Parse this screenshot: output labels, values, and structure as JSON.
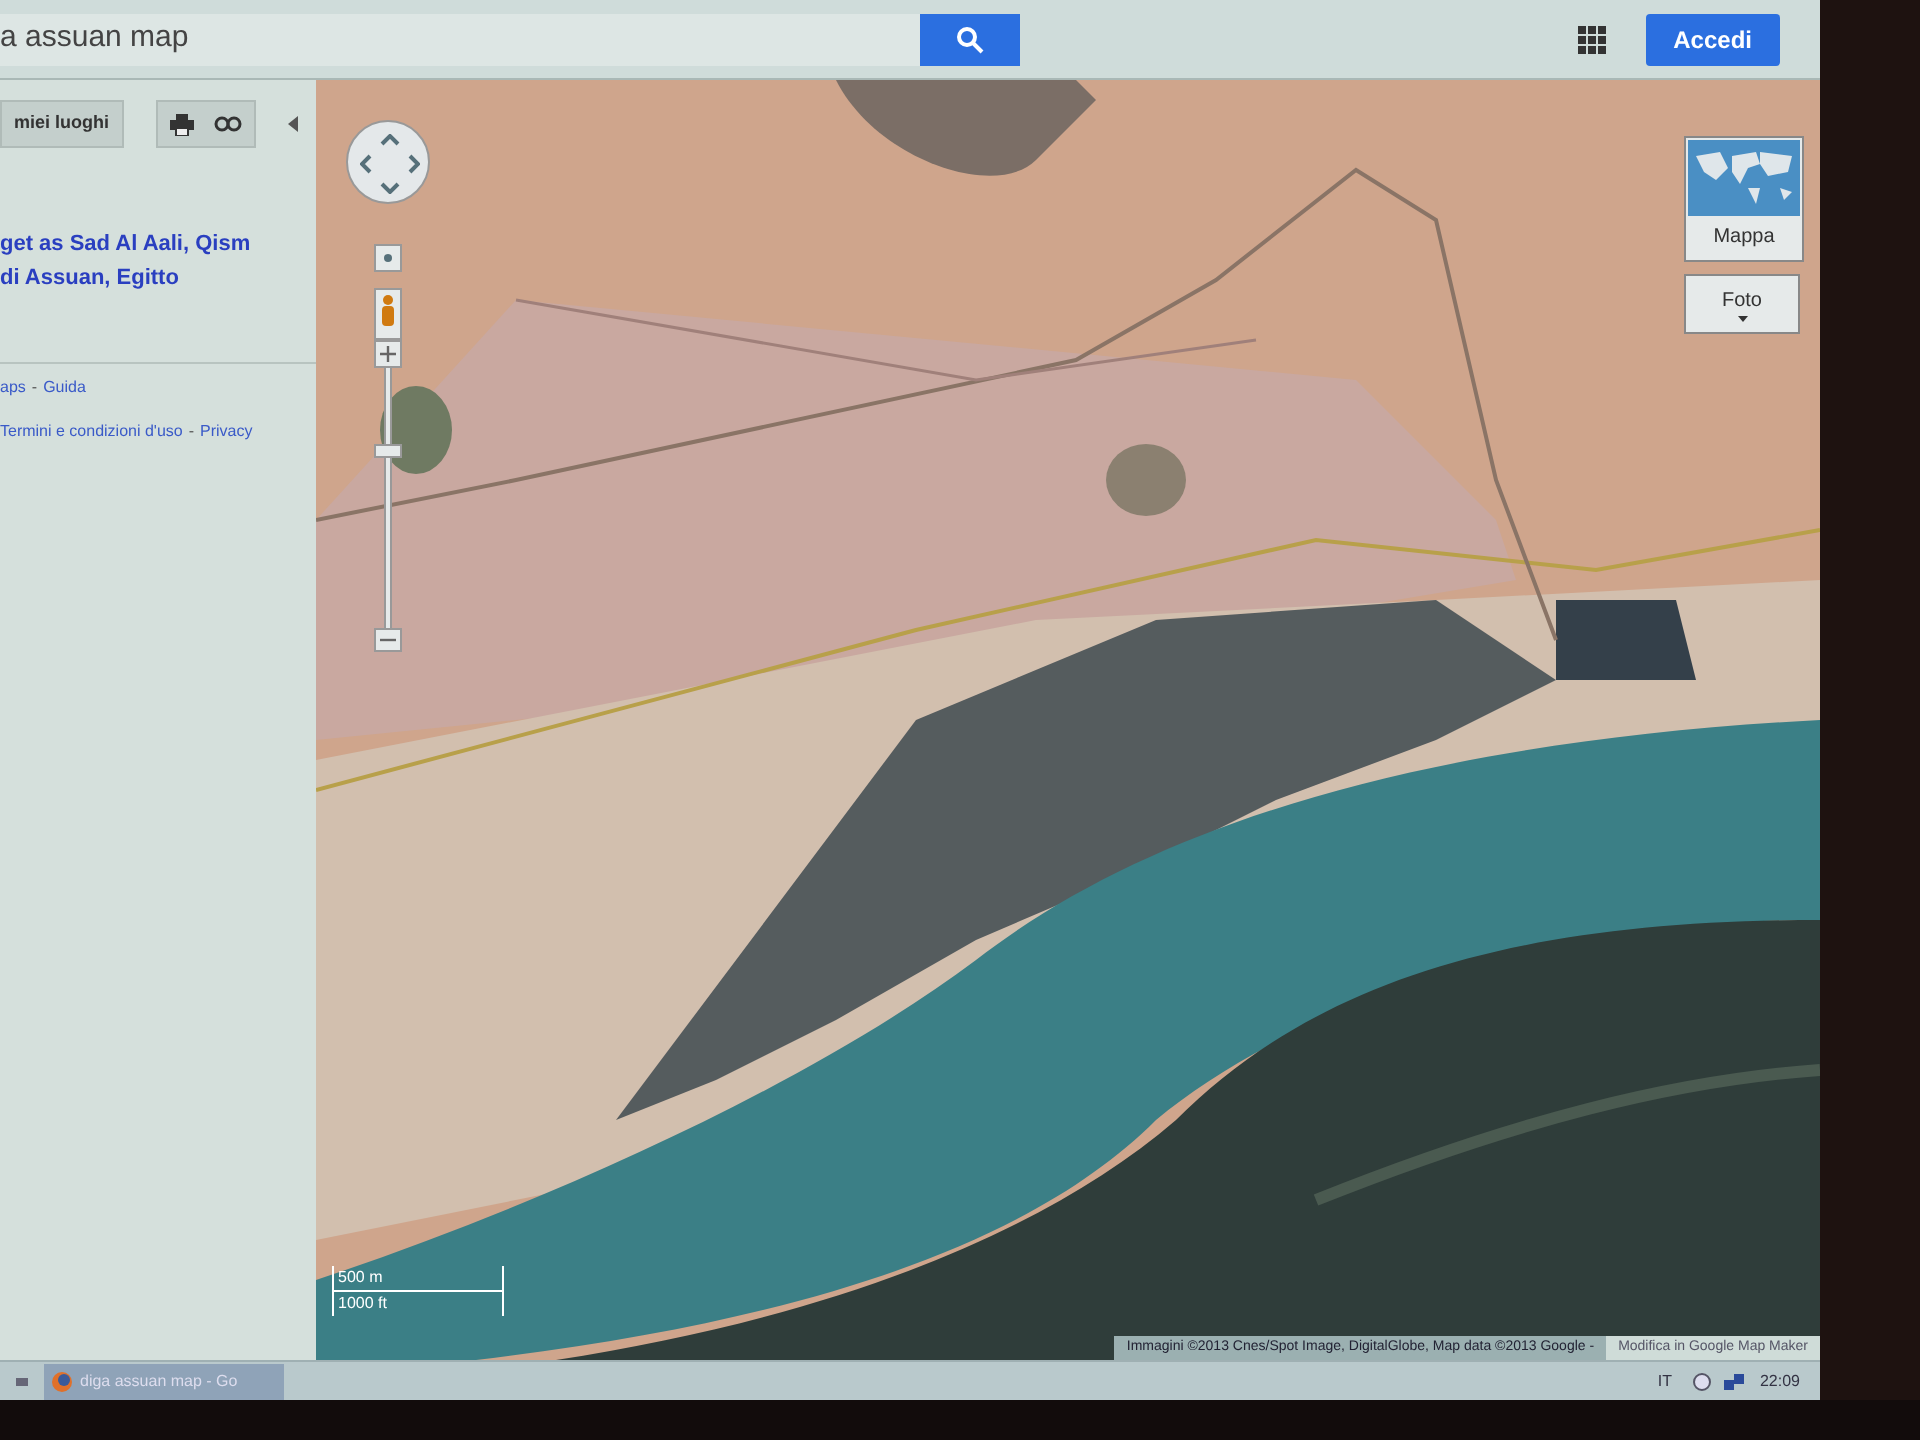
{
  "search": {
    "value": "a assuan map"
  },
  "header": {
    "sign_in": "Accedi"
  },
  "sidebar": {
    "my_places": "miei luoghi",
    "place_lines": [
      "get as Sad Al Aali, Qism",
      "di Assuan, Egitto"
    ],
    "footer_links": [
      [
        {
          "kind": "link",
          "text": "aps"
        },
        {
          "kind": "separator",
          "text": "-"
        },
        {
          "kind": "link",
          "text": "Guida"
        }
      ],
      [
        {
          "kind": "link",
          "text": "Termini e condizioni d'uso"
        },
        {
          "kind": "separator",
          "text": "-"
        },
        {
          "kind": "link",
          "text": "Privacy"
        }
      ]
    ]
  },
  "map": {
    "zoom": {
      "level": 0.71
    },
    "map_types": [
      {
        "label": "Mappa",
        "kind": "thumbnail"
      },
      {
        "label": "Foto",
        "kind": "dropdown"
      }
    ],
    "scale": [
      "500 m",
      "1000 ft"
    ],
    "attribution": "Immagini ©2013 Cnes/Spot Image, DigitalGlobe, Map data ©2013 Google -",
    "edit_link": "Modifica in Google Map Maker"
  },
  "taskbar": {
    "task": "diga assuan map - Go",
    "language": "IT",
    "time": "22:09"
  }
}
